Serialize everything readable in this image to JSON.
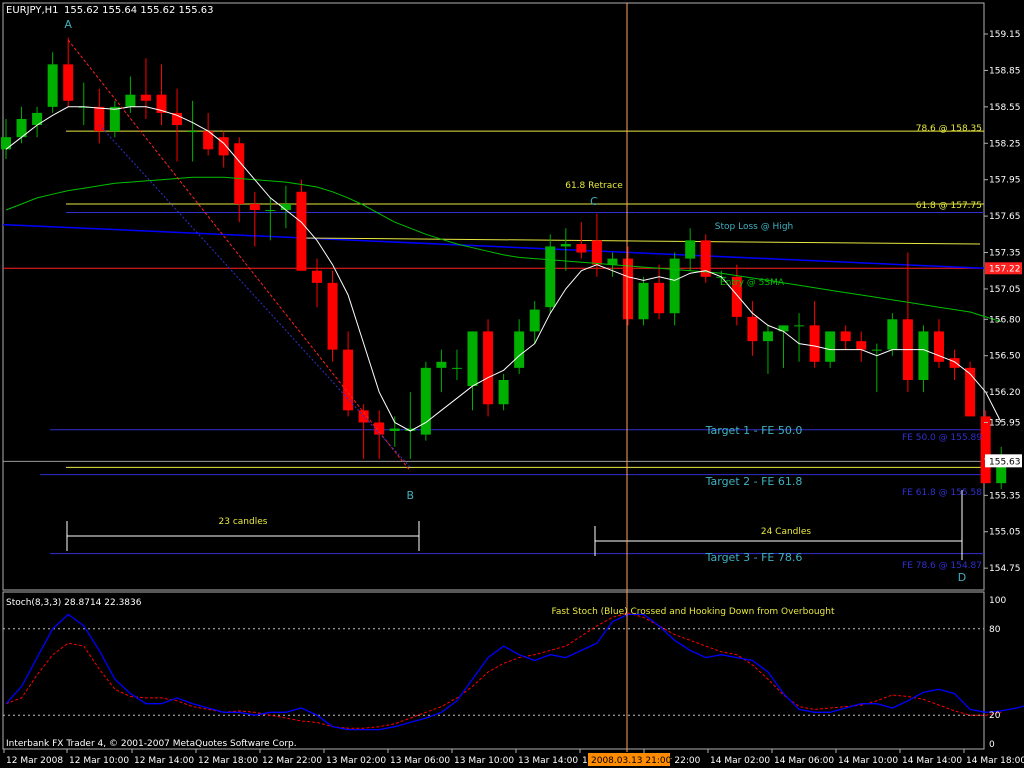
{
  "header": {
    "symbol_label": "EURJPY,H1",
    "quote_values": "155.62 155.64 155.62 155.63"
  },
  "footer": {
    "copyright": "Interbank FX Trader 4, © 2001-2007 MetaQuotes Software Corp."
  },
  "colors": {
    "background": "#000000",
    "border": "#b0b0b0",
    "bull_candle": "#00b000",
    "bear_candle": "#ff0000",
    "sma_fast": "#ffffff",
    "ma_green": "#00c000",
    "ma_blue": "#0000ff",
    "fib_yellow": "#e8e840",
    "cyan_label": "#40b0c0",
    "red_line": "#ff2020",
    "blue_line": "#3030d0",
    "crosshair": "#ffa060",
    "price_box": "#ffffff",
    "red_box": "#ff2020",
    "stoch_main": "#0000ff",
    "stoch_signal": "#ff0000",
    "time_box": "#ff8c00"
  },
  "chart_data": [
    {
      "type": "candlestick",
      "price_axis": {
        "range": [
          154.62,
          159.3
        ],
        "ticks": [
          "159.15",
          "158.85",
          "158.55",
          "158.25",
          "157.95",
          "157.65",
          "157.35",
          "157.05",
          "156.80",
          "156.50",
          "156.20",
          "155.95",
          "155.65",
          "155.35",
          "155.05",
          "154.75"
        ],
        "current_price": "155.63",
        "red_level_label": "157.22"
      },
      "time_axis": {
        "ticks": [
          "12 Mar 2008",
          "12 Mar 10:00",
          "12 Mar 14:00",
          "12 Mar 18:00",
          "12 Mar 22:00",
          "13 Mar 02:00",
          "13 Mar 06:00",
          "13 Mar 10:00",
          "13 Mar 14:00",
          "13",
          "3 Mar 22:00",
          "14 Mar 02:00",
          "14 Mar 06:00",
          "14 Mar 10:00",
          "14 Mar 14:00",
          "14 Mar 18:00"
        ],
        "cursor_time": "2008.03.13 21:00"
      },
      "candles": [
        {
          "o": 158.2,
          "h": 158.45,
          "l": 158.12,
          "c": 158.3
        },
        {
          "o": 158.3,
          "h": 158.55,
          "l": 158.25,
          "c": 158.45
        },
        {
          "o": 158.4,
          "h": 158.55,
          "l": 158.3,
          "c": 158.5
        },
        {
          "o": 158.55,
          "h": 159.0,
          "l": 158.5,
          "c": 158.9
        },
        {
          "o": 158.9,
          "h": 159.12,
          "l": 158.55,
          "c": 158.6
        },
        {
          "o": 158.55,
          "h": 158.75,
          "l": 158.4,
          "c": 158.55
        },
        {
          "o": 158.55,
          "h": 158.7,
          "l": 158.25,
          "c": 158.35
        },
        {
          "o": 158.35,
          "h": 158.6,
          "l": 158.3,
          "c": 158.55
        },
        {
          "o": 158.55,
          "h": 158.8,
          "l": 158.5,
          "c": 158.65
        },
        {
          "o": 158.65,
          "h": 158.95,
          "l": 158.45,
          "c": 158.6
        },
        {
          "o": 158.65,
          "h": 158.9,
          "l": 158.4,
          "c": 158.5
        },
        {
          "o": 158.5,
          "h": 158.7,
          "l": 158.1,
          "c": 158.4
        },
        {
          "o": 158.35,
          "h": 158.6,
          "l": 158.1,
          "c": 158.35
        },
        {
          "o": 158.35,
          "h": 158.5,
          "l": 158.15,
          "c": 158.2
        },
        {
          "o": 158.3,
          "h": 158.35,
          "l": 158.05,
          "c": 158.15
        },
        {
          "o": 158.25,
          "h": 158.3,
          "l": 157.6,
          "c": 157.75
        },
        {
          "o": 157.75,
          "h": 157.85,
          "l": 157.4,
          "c": 157.7
        },
        {
          "o": 157.7,
          "h": 157.8,
          "l": 157.45,
          "c": 157.7
        },
        {
          "o": 157.7,
          "h": 157.9,
          "l": 157.55,
          "c": 157.75
        },
        {
          "o": 157.85,
          "h": 157.95,
          "l": 157.35,
          "c": 157.2
        },
        {
          "o": 157.2,
          "h": 157.3,
          "l": 156.9,
          "c": 157.1
        },
        {
          "o": 157.1,
          "h": 157.2,
          "l": 156.45,
          "c": 156.55
        },
        {
          "o": 156.55,
          "h": 156.7,
          "l": 156.0,
          "c": 156.05
        },
        {
          "o": 156.05,
          "h": 156.1,
          "l": 155.65,
          "c": 155.95
        },
        {
          "o": 155.95,
          "h": 156.05,
          "l": 155.65,
          "c": 155.85
        },
        {
          "o": 155.88,
          "h": 156.0,
          "l": 155.75,
          "c": 155.9
        },
        {
          "o": 155.88,
          "h": 156.2,
          "l": 155.65,
          "c": 155.9
        },
        {
          "o": 155.85,
          "h": 156.45,
          "l": 155.8,
          "c": 156.4
        },
        {
          "o": 156.4,
          "h": 156.55,
          "l": 156.2,
          "c": 156.45
        },
        {
          "o": 156.4,
          "h": 156.55,
          "l": 156.3,
          "c": 156.4
        },
        {
          "o": 156.25,
          "h": 156.7,
          "l": 156.05,
          "c": 156.7
        },
        {
          "o": 156.7,
          "h": 156.8,
          "l": 156.0,
          "c": 156.1
        },
        {
          "o": 156.1,
          "h": 156.35,
          "l": 156.05,
          "c": 156.3
        },
        {
          "o": 156.4,
          "h": 156.8,
          "l": 156.35,
          "c": 156.7
        },
        {
          "o": 156.7,
          "h": 156.95,
          "l": 156.6,
          "c": 156.88
        },
        {
          "o": 156.9,
          "h": 157.5,
          "l": 156.85,
          "c": 157.4
        },
        {
          "o": 157.4,
          "h": 157.55,
          "l": 157.2,
          "c": 157.42
        },
        {
          "o": 157.42,
          "h": 157.6,
          "l": 157.3,
          "c": 157.35
        },
        {
          "o": 157.45,
          "h": 157.67,
          "l": 157.15,
          "c": 157.25
        },
        {
          "o": 157.25,
          "h": 157.35,
          "l": 157.15,
          "c": 157.3
        },
        {
          "o": 157.3,
          "h": 157.4,
          "l": 156.75,
          "c": 156.8
        },
        {
          "o": 156.8,
          "h": 157.15,
          "l": 156.75,
          "c": 157.1
        },
        {
          "o": 157.1,
          "h": 157.25,
          "l": 156.8,
          "c": 156.85
        },
        {
          "o": 156.85,
          "h": 157.35,
          "l": 156.75,
          "c": 157.3
        },
        {
          "o": 157.3,
          "h": 157.55,
          "l": 157.2,
          "c": 157.45
        },
        {
          "o": 157.45,
          "h": 157.5,
          "l": 157.1,
          "c": 157.15
        },
        {
          "o": 157.15,
          "h": 157.2,
          "l": 157.1,
          "c": 157.15
        },
        {
          "o": 157.15,
          "h": 157.25,
          "l": 156.75,
          "c": 156.82
        },
        {
          "o": 156.82,
          "h": 156.95,
          "l": 156.5,
          "c": 156.62
        },
        {
          "o": 156.62,
          "h": 156.75,
          "l": 156.35,
          "c": 156.7
        },
        {
          "o": 156.7,
          "h": 156.75,
          "l": 156.4,
          "c": 156.75
        },
        {
          "o": 156.75,
          "h": 156.85,
          "l": 156.45,
          "c": 156.75
        },
        {
          "o": 156.75,
          "h": 156.95,
          "l": 156.4,
          "c": 156.45
        },
        {
          "o": 156.45,
          "h": 156.7,
          "l": 156.4,
          "c": 156.7
        },
        {
          "o": 156.7,
          "h": 156.75,
          "l": 156.55,
          "c": 156.62
        },
        {
          "o": 156.62,
          "h": 156.7,
          "l": 156.45,
          "c": 156.55
        },
        {
          "o": 156.55,
          "h": 156.6,
          "l": 156.2,
          "c": 156.55
        },
        {
          "o": 156.55,
          "h": 156.85,
          "l": 156.5,
          "c": 156.8
        },
        {
          "o": 156.8,
          "h": 157.35,
          "l": 156.2,
          "c": 156.3
        },
        {
          "o": 156.3,
          "h": 156.75,
          "l": 156.2,
          "c": 156.7
        },
        {
          "o": 156.7,
          "h": 156.8,
          "l": 156.4,
          "c": 156.45
        },
        {
          "o": 156.48,
          "h": 156.55,
          "l": 156.3,
          "c": 156.4
        },
        {
          "o": 156.4,
          "h": 156.45,
          "l": 156.05,
          "c": 156.0
        },
        {
          "o": 156.0,
          "h": 156.05,
          "l": 155.45,
          "c": 155.45
        },
        {
          "o": 155.45,
          "h": 155.75,
          "l": 155.4,
          "c": 155.63
        }
      ],
      "overlays": {
        "sma_fast_label": "Entry @ 5SMA",
        "sma_fast": [
          158.2,
          158.3,
          158.4,
          158.48,
          158.55,
          158.55,
          158.54,
          158.53,
          158.55,
          158.55,
          158.52,
          158.48,
          158.42,
          158.35,
          158.25,
          158.1,
          157.95,
          157.8,
          157.7,
          157.6,
          157.45,
          157.25,
          157.0,
          156.6,
          156.2,
          155.95,
          155.88,
          155.95,
          156.05,
          156.15,
          156.25,
          156.32,
          156.38,
          156.5,
          156.6,
          156.85,
          157.05,
          157.2,
          157.25,
          157.2,
          157.15,
          157.12,
          157.15,
          157.12,
          157.18,
          157.2,
          157.15,
          157.0,
          156.85,
          156.75,
          156.7,
          156.6,
          156.58,
          156.55,
          156.55,
          156.55,
          156.5,
          156.55,
          156.55,
          156.55,
          156.5,
          156.45,
          156.35,
          156.2,
          155.95
        ],
        "ma_green": [
          157.7,
          157.75,
          157.8,
          157.83,
          157.86,
          157.88,
          157.9,
          157.92,
          157.93,
          157.94,
          157.95,
          157.96,
          157.97,
          157.97,
          157.97,
          157.96,
          157.95,
          157.94,
          157.93,
          157.91,
          157.89,
          157.85,
          157.8,
          157.74,
          157.67,
          157.6,
          157.55,
          157.5,
          157.46,
          157.42,
          157.39,
          157.36,
          157.33,
          157.31,
          157.3,
          157.29,
          157.28,
          157.27,
          157.26,
          157.25,
          157.24,
          157.23,
          157.22,
          157.21,
          157.2,
          157.19,
          157.18,
          157.16,
          157.14,
          157.12,
          157.1,
          157.08,
          157.06,
          157.04,
          157.02,
          157.0,
          156.98,
          156.96,
          156.94,
          156.92,
          156.9,
          156.88,
          156.86,
          156.82,
          156.78
        ],
        "ma_blue_start": 157.58,
        "ma_blue_end": 157.22,
        "yellow_ma_start": 157.47,
        "yellow_ma_end": 157.42,
        "red_level": 157.22,
        "fib_788": 158.35,
        "fib_618": 157.75,
        "stop_high": 157.68,
        "fe_500": 155.89,
        "fe_618": 155.58,
        "fe_786": 154.87,
        "grey_line": 155.63
      },
      "labels": {
        "fib_788_label": "78.6 @ 158.35",
        "fib_618_label": "61.8 @ 157.75",
        "stop_label": "Stop Loss @ High",
        "retrace_label": "61.8 Retrace",
        "target1_label": "Target 1 - FE 50.0",
        "target2_label": "Target 2 - FE 61.8",
        "target3_label": "Target 3 - FE 78.6",
        "fe500_label": "FE 50.0 @ 155.89",
        "fe618_label": "FE 61.8 @ 155.58",
        "fe786_label": "FE 78.6 @ 154.87",
        "candles23_label": "23 candles",
        "candles24_label": "24 Candles",
        "point_a": "A",
        "point_b": "B",
        "point_c": "C",
        "point_d": "D"
      }
    },
    {
      "type": "line",
      "title": "Stoch(8,3,3) 28.8714 22.3836",
      "annotation": "Fast Stoch (Blue) Crossed and Hooking Down from Overbought",
      "y_ticks": [
        "100",
        "80",
        "20",
        "0"
      ],
      "levels": [
        80,
        20
      ],
      "ylim": [
        0,
        100
      ],
      "main": [
        28,
        40,
        60,
        80,
        90,
        82,
        65,
        45,
        35,
        28,
        28,
        32,
        28,
        25,
        22,
        22,
        20,
        22,
        22,
        25,
        20,
        12,
        10,
        10,
        10,
        12,
        15,
        18,
        22,
        30,
        45,
        60,
        68,
        62,
        58,
        62,
        60,
        65,
        70,
        85,
        90,
        90,
        82,
        72,
        65,
        60,
        62,
        60,
        58,
        50,
        35,
        24,
        22,
        22,
        25,
        28,
        28,
        25,
        30,
        36,
        38,
        35,
        24,
        22,
        23,
        25,
        28
      ],
      "signal": [
        28,
        32,
        48,
        62,
        70,
        68,
        52,
        38,
        33,
        32,
        32,
        30,
        26,
        24,
        22,
        23,
        22,
        20,
        18,
        16,
        15,
        12,
        11,
        11,
        12,
        14,
        18,
        22,
        26,
        32,
        40,
        50,
        56,
        60,
        62,
        65,
        68,
        75,
        82,
        88,
        91,
        88,
        82,
        76,
        72,
        68,
        64,
        62,
        55,
        45,
        34,
        26,
        24,
        25,
        26,
        27,
        30,
        34,
        33,
        31,
        27,
        23,
        20,
        20,
        22
      ]
    }
  ]
}
